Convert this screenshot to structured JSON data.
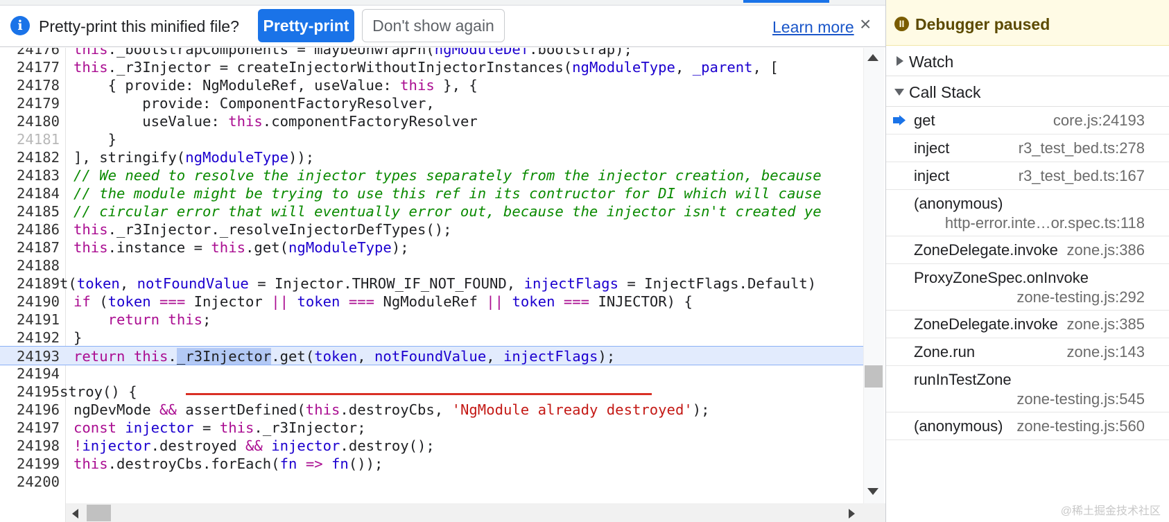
{
  "infobar": {
    "icon": "info-icon",
    "message": "Pretty-print this minified file?",
    "pretty_print_label": "Pretty-print",
    "dont_show_label": "Don't show again",
    "learn_more_label": "Learn more",
    "close_symbol": "×",
    "accent_color": "#1a73e8"
  },
  "editor": {
    "current_line": 24193,
    "lines": [
      {
        "n": "24176",
        "html": "<span class=\"k\">this</span>._bootstrapComponents = maybeUnwrapFn(<span class=\"v\">ngModuleDef</span>.bootstrap);"
      },
      {
        "n": "24177",
        "html": "<span class=\"k\">this</span>._r3Injector = createInjectorWithoutInjectorInstances(<span class=\"v\">ngModuleType</span>, <span class=\"v\">_parent</span>, ["
      },
      {
        "n": "24178",
        "html": "    { provide: NgModuleRef, useValue: <span class=\"k\">this</span> }, {"
      },
      {
        "n": "24179",
        "html": "        provide: ComponentFactoryResolver,"
      },
      {
        "n": "24180",
        "html": "        useValue: <span class=\"k\">this</span>.componentFactoryResolver"
      },
      {
        "n": "24181",
        "dim": true,
        "html": "    }"
      },
      {
        "n": "24182",
        "html": "], stringify(<span class=\"v\">ngModuleType</span>));"
      },
      {
        "n": "24183",
        "html": "<span class=\"c\">// We need to resolve the injector types separately from the injector creation, because</span>"
      },
      {
        "n": "24184",
        "html": "<span class=\"c\">// the module might be trying to use this ref in its contructor for DI which will cause</span>"
      },
      {
        "n": "24185",
        "html": "<span class=\"c\">// circular error that will eventually error out, because the injector isn't created ye</span>"
      },
      {
        "n": "24186",
        "html": "<span class=\"k\">this</span>._r3Injector._resolveInjectorDefTypes();"
      },
      {
        "n": "24187",
        "html": "<span class=\"k\">this</span>.instance = <span class=\"k\">this</span>.get(<span class=\"v\">ngModuleType</span>);"
      },
      {
        "n": "24188",
        "html": ""
      },
      {
        "n": "24189",
        "outdent": true,
        "html": "t(<span class=\"v\">token</span>, <span class=\"v\">notFoundValue</span> = Injector.THROW_IF_NOT_FOUND, <span class=\"v\">injectFlags</span> = InjectFlags.Default)"
      },
      {
        "n": "24190",
        "html": "<span class=\"k\">if</span> (<span class=\"v\">token</span> <span class=\"k\">===</span> Injector <span class=\"k\">||</span> <span class=\"v\">token</span> <span class=\"k\">===</span> NgModuleRef <span class=\"k\">||</span> <span class=\"v\">token</span> <span class=\"k\">===</span> INJECTOR) {"
      },
      {
        "n": "24191",
        "html": "    <span class=\"k\">return</span> <span class=\"k\">this</span>;"
      },
      {
        "n": "24192",
        "html": "}"
      },
      {
        "n": "24193",
        "active": true,
        "html": "<span class=\"k\">return</span> <span class=\"k\">this</span>.<span class=\"sel\">_r3Injector</span>.get(<span class=\"v\">token</span>, <span class=\"v\">notFoundValue</span>, <span class=\"v\">injectFlags</span>);"
      },
      {
        "n": "24194",
        "html": ""
      },
      {
        "n": "24195",
        "outdent": true,
        "html": "stroy() {"
      },
      {
        "n": "24196",
        "html": "ngDevMode <span class=\"k\">&amp;&amp;</span> assertDefined(<span class=\"k\">this</span>.destroyCbs, <span class=\"s\">'NgModule already destroyed'</span>);"
      },
      {
        "n": "24197",
        "html": "<span class=\"k\">const</span> <span class=\"v\">injector</span> = <span class=\"k\">this</span>._r3Injector;"
      },
      {
        "n": "24198",
        "html": "<span class=\"k\">!</span><span class=\"v\">injector</span>.destroyed <span class=\"k\">&amp;&amp;</span> <span class=\"v\">injector</span>.destroy();"
      },
      {
        "n": "24199",
        "html": "<span class=\"k\">this</span>.destroyCbs.forEach(<span class=\"v\">fn</span> <span class=\"k\">=&gt;</span> <span class=\"v\">fn</span>());"
      },
      {
        "n": "24200",
        "html": ""
      }
    ]
  },
  "debugger": {
    "paused_label": "Debugger paused",
    "paused_icon": "pause-icon",
    "watch_label": "Watch",
    "call_stack_label": "Call Stack",
    "frames": [
      {
        "name": "get",
        "location": "core.js:24193",
        "current": true
      },
      {
        "name": "inject",
        "location": "r3_test_bed.ts:278"
      },
      {
        "name": "inject",
        "location": "r3_test_bed.ts:167"
      },
      {
        "name": "(anonymous)",
        "location": "http-error.inte…or.spec.ts:118"
      },
      {
        "name": "ZoneDelegate.invoke",
        "location": "zone.js:386"
      },
      {
        "name": "ProxyZoneSpec.onInvoke",
        "location": "zone-testing.js:292"
      },
      {
        "name": "ZoneDelegate.invoke",
        "location": "zone.js:385"
      },
      {
        "name": "Zone.run",
        "location": "zone.js:143"
      },
      {
        "name": "runInTestZone",
        "location": "zone-testing.js:545"
      },
      {
        "name": "(anonymous)",
        "location": "zone-testing.js:560"
      }
    ]
  },
  "watermark": "@稀土掘金技术社区"
}
